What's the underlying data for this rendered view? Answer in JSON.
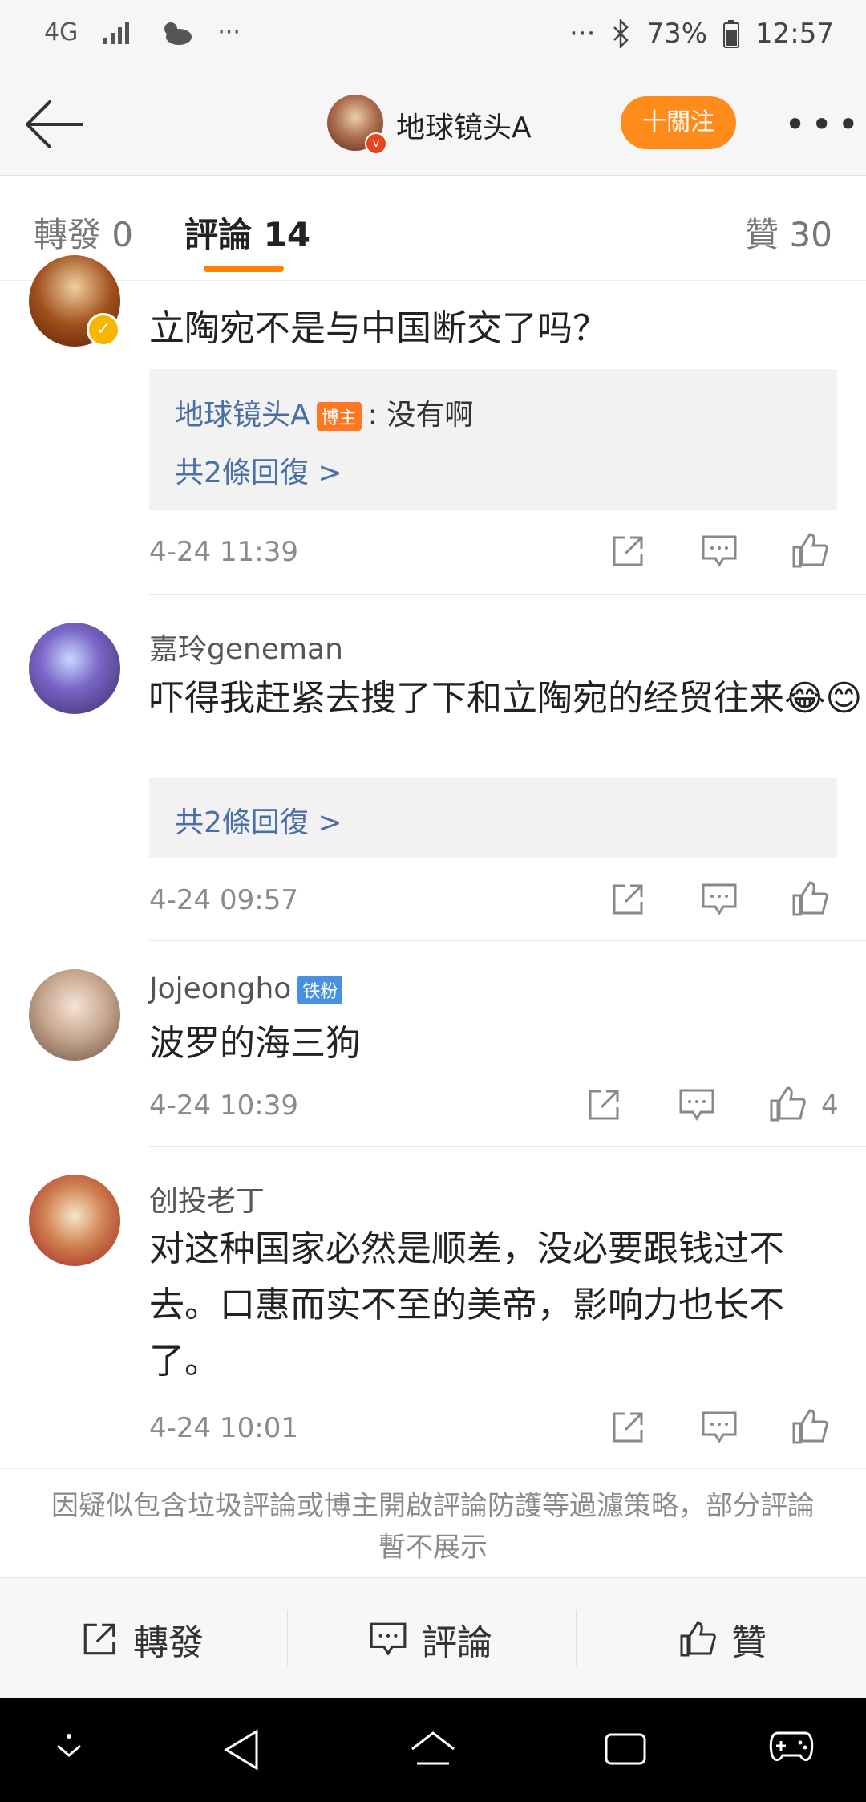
{
  "status_bar": {
    "network": "4G",
    "battery": "73%",
    "time": "12:57",
    "dots": "···"
  },
  "header": {
    "title": "地球镜头A",
    "follow_label": "十關注",
    "verified_mark": "v"
  },
  "tabs": {
    "repost": "轉發 0",
    "comment": "評論 14",
    "like": "贊 30"
  },
  "comments": [
    {
      "text": "立陶宛不是与中国断交了吗？",
      "reply": {
        "author": "地球镜头A",
        "badge": "博主",
        "text": ": 没有啊",
        "more": "共2條回復 >"
      },
      "time": "4-24 11:39"
    },
    {
      "name": "嘉玲geneman",
      "text": "吓得我赶紧去搜了下和立陶宛的经贸往来😂😊",
      "reply": {
        "more": "共2條回復 >"
      },
      "time": "4-24 09:57"
    },
    {
      "name": "Jojeongho",
      "badge": "铁粉",
      "text": "波罗的海三狗",
      "time": "4-24 10:39",
      "likes": "4"
    },
    {
      "name": "创投老丁",
      "text": "对这种国家必然是顺差，没必要跟钱过不去。口惠而实不至的美帝，影响力也长不了。",
      "time": "4-24 10:01"
    }
  ],
  "filter_note": "因疑似包含垃圾評論或博主開啟評論防護等過濾策略，部分評論暫不展示",
  "bottom_bar": {
    "repost": "轉發",
    "comment": "評論",
    "like": "贊"
  },
  "colors": {
    "accent": "#ff8200",
    "link": "#4a6fa5",
    "follow": "#ff8c1a"
  }
}
